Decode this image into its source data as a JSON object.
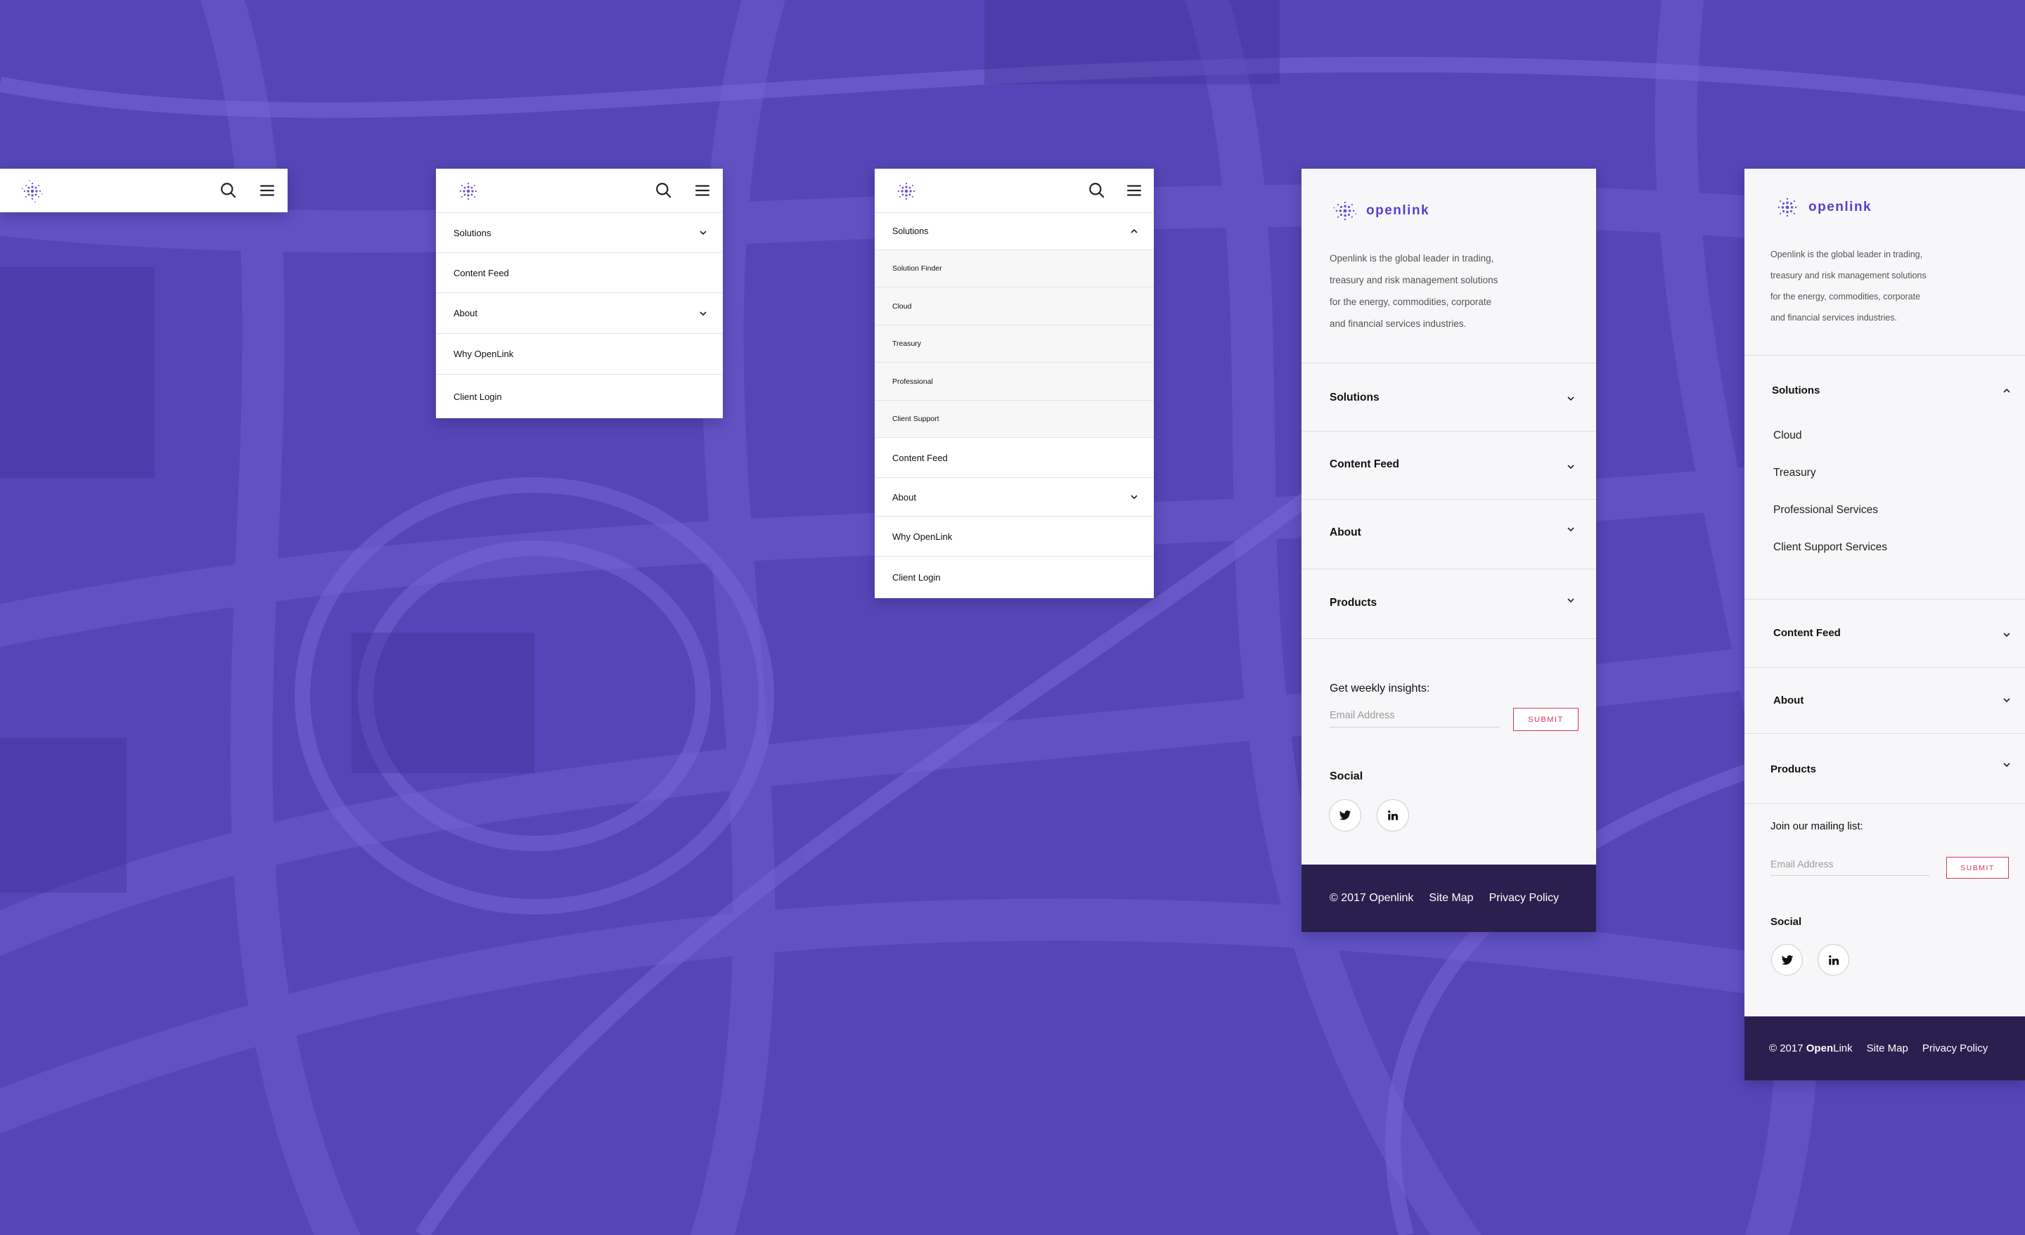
{
  "brand": {
    "name": "openlink",
    "color": "#5b3dd0"
  },
  "colors": {
    "overlay": "#5446b6",
    "road": "#6a5cd0",
    "footer": "#2b1f4f",
    "accent": "#d63a5a"
  },
  "icons": {
    "logo": "openlink-logo-icon",
    "search": "search-icon",
    "menu": "hamburger-icon",
    "chevron_down": "chevron-down-icon",
    "chevron_up": "chevron-up-icon",
    "twitter": "twitter-icon",
    "linkedin": "linkedin-icon"
  },
  "panel2": {
    "items": [
      {
        "label": "Solutions"
      },
      {
        "label": "Content Feed"
      },
      {
        "label": "About"
      },
      {
        "label": "Why OpenLink"
      },
      {
        "label": "Client Login"
      }
    ]
  },
  "panel3": {
    "solutions": "Solutions",
    "subitems": [
      "Solution Finder",
      "Cloud",
      "Treasury",
      "Professional",
      "Client Support"
    ],
    "items": [
      "Content Feed",
      "About",
      "Why OpenLink",
      "Client Login"
    ]
  },
  "panel4": {
    "intro": [
      "Openlink is the global leader in trading,",
      "treasury and risk management solutions",
      "for the energy, commodities, corporate",
      "and financial services industries."
    ],
    "sections": [
      "Solutions",
      "Content Feed",
      "About",
      "Products"
    ],
    "newsletter_label": "Get weekly insights:",
    "email_placeholder": "Email Address",
    "submit": "SUBMIT",
    "social_label": "Social",
    "copyright": "© 2017 Openlink",
    "sitemap": "Site Map",
    "privacy": "Privacy Policy"
  },
  "panel5": {
    "intro": [
      "Openlink is the global leader in trading,",
      "treasury and risk management solutions",
      "for the energy, commodities, corporate",
      "and financial services industries."
    ],
    "solutions": "Solutions",
    "subitems": [
      "Cloud",
      "Treasury",
      "Professional Services",
      "Client Support Services"
    ],
    "sections": [
      "Content Feed",
      "About",
      "Products"
    ],
    "newsletter_label": "Join our mailing list:",
    "email_placeholder": "Email Address",
    "submit": "SUBMIT",
    "social_label": "Social",
    "copyright_prefix": "© 2017 ",
    "copyright_open": "Open",
    "copyright_link": "Link",
    "sitemap": "Site Map",
    "privacy": "Privacy Policy"
  }
}
